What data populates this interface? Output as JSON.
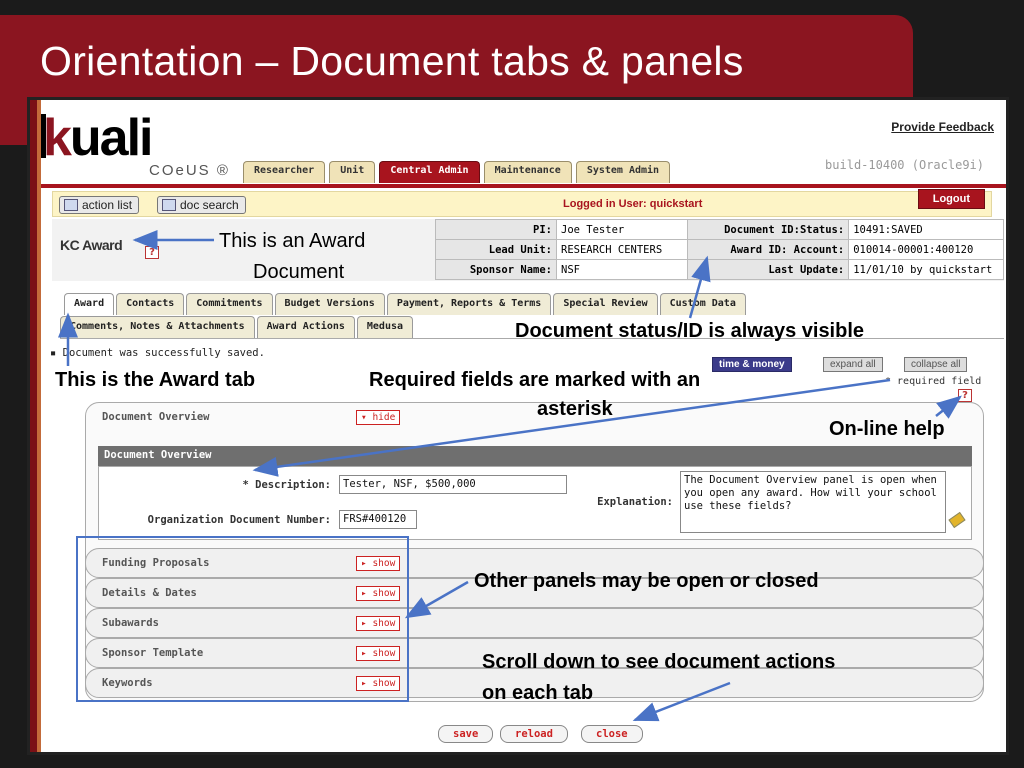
{
  "slide": {
    "title": "Orientation – Document tabs & panels"
  },
  "header": {
    "logo_k": "k",
    "logo_rest": "uali",
    "coeus": "COeUS ®",
    "provide_feedback": "Provide Feedback",
    "build": "build-10400 (Oracle9i)",
    "tabs": [
      "Researcher",
      "Unit",
      "Central Admin",
      "Maintenance",
      "System Admin"
    ]
  },
  "toolbar": {
    "action_list": "action list",
    "doc_search": "doc search",
    "logged_in": "Logged in User: quickstart",
    "logout": "Logout"
  },
  "doc_header": {
    "type": "KC Award",
    "rows": [
      {
        "l1": "PI:",
        "v1": "Joe Tester",
        "l2": "Document ID:Status:",
        "v2": "10491:SAVED"
      },
      {
        "l1": "Lead Unit:",
        "v1": "RESEARCH CENTERS",
        "l2": "Award ID: Account:",
        "v2": "010014-00001:400120"
      },
      {
        "l1": "Sponsor Name:",
        "v1": "NSF",
        "l2": "Last Update:",
        "v2": "11/01/10 by quickstart"
      }
    ]
  },
  "doc_tabs": [
    "Award",
    "Contacts",
    "Commitments",
    "Budget Versions",
    "Payment, Reports & Terms",
    "Special Review",
    "Custom Data"
  ],
  "doc_tabs2": [
    "Comments, Notes & Attachments",
    "Award Actions",
    "Medusa"
  ],
  "messages": {
    "saved": "▪ Document was successfully saved."
  },
  "controls": {
    "time_money": "time & money",
    "expand_all": "expand all",
    "collapse_all": "collapse all",
    "required_field": "* required field"
  },
  "document_overview": {
    "panel_title": "Document Overview",
    "hide": "▾ hide",
    "section_title": "Document Overview",
    "description_label": "* Description:",
    "description_value": "Tester, NSF, $500,000",
    "org_doc_label": "Organization Document Number:",
    "org_doc_value": "FRS#400120",
    "explanation_label": "Explanation:",
    "explanation_value": "The Document Overview panel is open when you open any award.  How will your school use these fields?"
  },
  "panels": [
    {
      "title": "Funding Proposals",
      "button": "▸ show"
    },
    {
      "title": "Details & Dates",
      "button": "▸ show"
    },
    {
      "title": "Subawards",
      "button": "▸ show"
    },
    {
      "title": "Sponsor Template",
      "button": "▸ show"
    },
    {
      "title": "Keywords",
      "button": "▸ show"
    }
  ],
  "actions": {
    "save": "save",
    "reload": "reload",
    "close": "close"
  },
  "annotations": {
    "award_doc_1": "This is an Award",
    "award_doc_2": "Document",
    "status_visible": "Document status/ID is always visible",
    "award_tab": "This is the Award tab",
    "required_1": "Required  fields are marked with an",
    "required_2": "asterisk",
    "online_help": "On-line help",
    "panels_open": "Other panels may be open or closed",
    "scroll_1": "Scroll down to see document actions",
    "scroll_2": "on each tab"
  },
  "colors": {
    "banner": "#8b1520",
    "kuali_red": "#a8141e",
    "annotation_arrow": "#4a73c6"
  }
}
